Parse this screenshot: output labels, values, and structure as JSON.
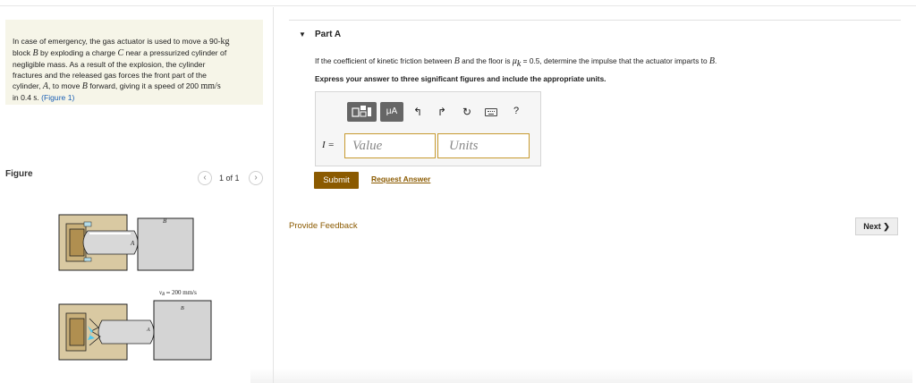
{
  "problem": {
    "text_html": "In case of emergency, the gas actuator is used to move a 90-<span style=\"font-family:'Liberation Serif',serif;font-size:10px\">kg</span><br>block <i>B</i> by exploding a charge <i>C</i> near a pressurized cylinder of<br>negligible mass. As a result of the explosion, the cylinder<br>fractures and the released gas forces the front part of the<br>cylinder, <i>A</i>, to move <i>B</i> forward, giving it a speed of 200 <span style=\"font-family:'Liberation Serif',serif;font-size:10px\">mm/s</span><br>in 0.4 <span style=\"font-family:'Liberation Serif',serif;font-size:10px\">s</span>. <span class=\"link\">(Figure 1)</span>"
  },
  "figure": {
    "title": "Figure",
    "prev_icon": "chevron-left-icon",
    "next_icon": "chevron-right-icon",
    "page": "1 of 1",
    "label_B_top": "B",
    "label_A_top": "A",
    "label_vB": "v",
    "label_vB_sub": "B",
    "label_speed": "200 mm/s",
    "label_B_bottom": "B",
    "label_A_bottom": "A"
  },
  "part_a": {
    "title": "Part A",
    "question_html": "If the coefficient of kinetic friction between <i>B</i> and the floor is <i>μ</i><sub style=\"font-size:7px\"><i>k</i></sub> = 0.5, determine the impulse that the actuator imparts to <i>B</i>.",
    "instruction": "Express your answer to three significant figures and include the appropriate units.",
    "toolbar": {
      "template_icon": "template-icon",
      "units_label": "μA",
      "undo_icon": "undo-icon",
      "redo_icon": "redo-icon",
      "reset_icon": "reset-icon",
      "keyboard_icon": "keyboard-icon",
      "help_label": "?"
    },
    "variable_label": "I =",
    "value_placeholder": "Value",
    "units_placeholder": "Units",
    "submit_label": "Submit",
    "request_answer_label": "Request Answer"
  },
  "feedback_label": "Provide Feedback",
  "next_label": "Next ❯",
  "colors": {
    "accent": "#8b5a00",
    "problem_bg": "#f6f5e8",
    "link": "#1a5fb4",
    "field_border": "#c79a2f"
  }
}
